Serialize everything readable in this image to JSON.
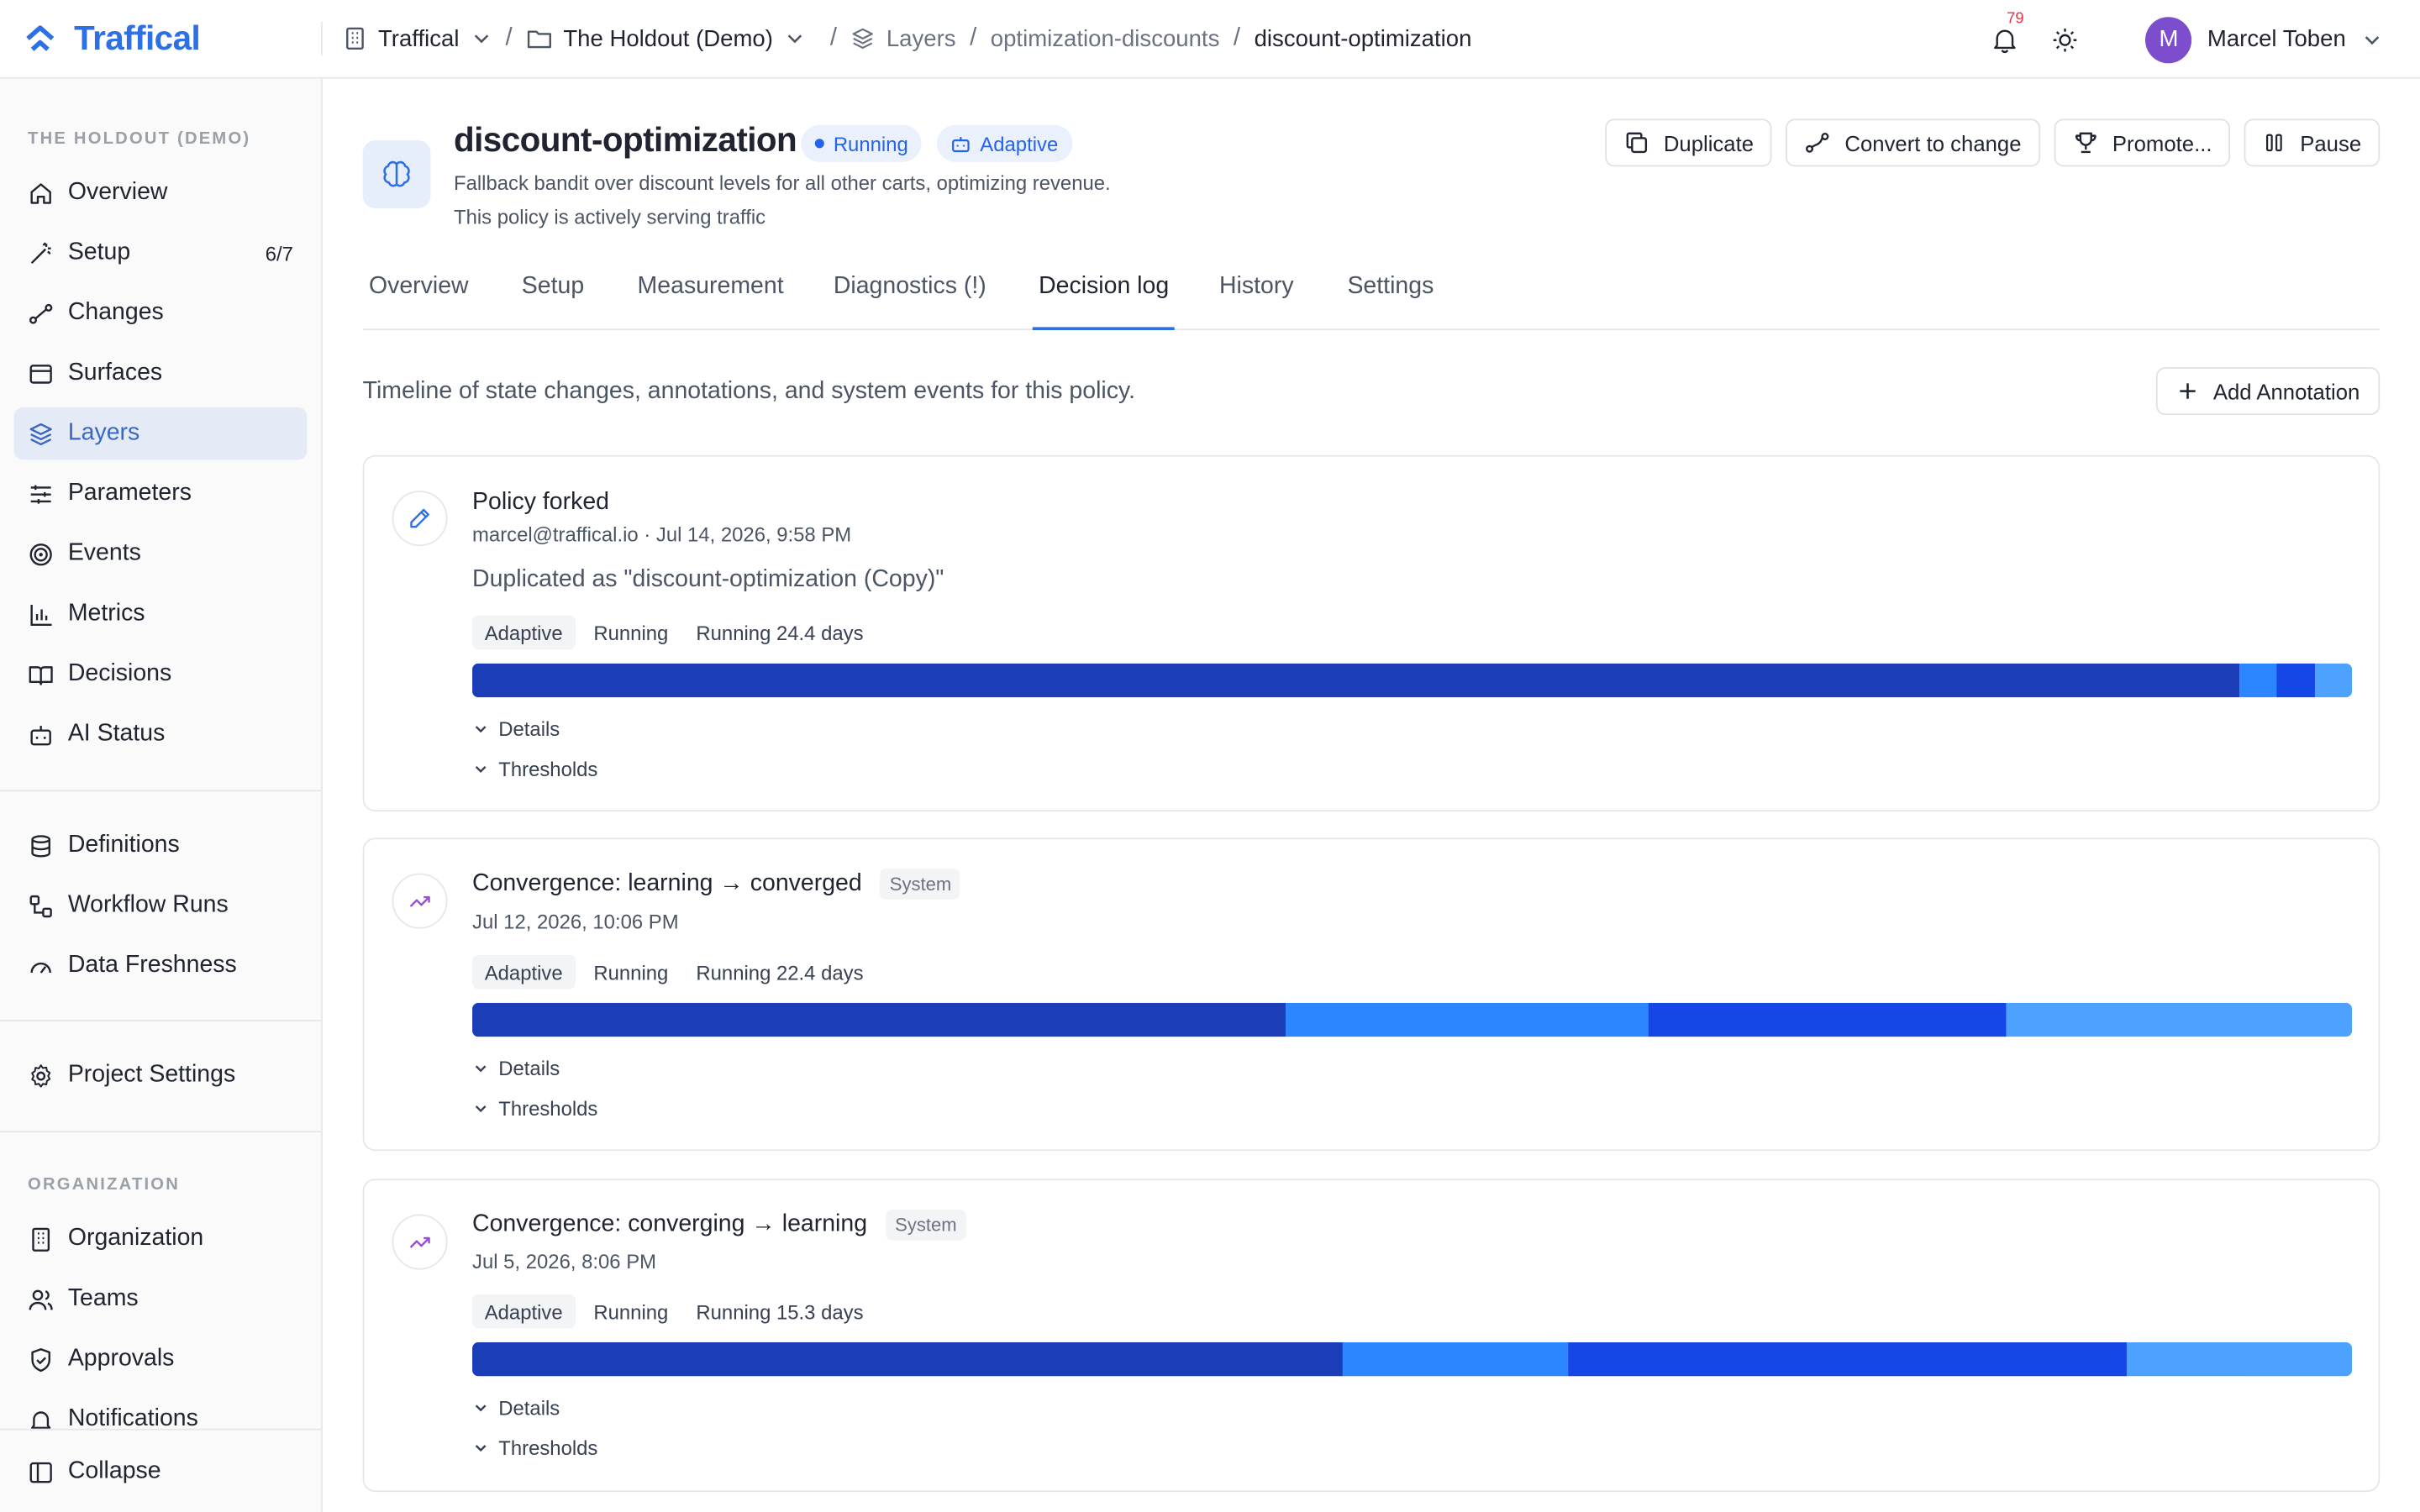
{
  "app": {
    "brand": "Traffical"
  },
  "breadcrumb": {
    "org": "Traffical",
    "project": "The Holdout (Demo)",
    "layers": "Layers",
    "layer": "optimization-discounts",
    "policy": "discount-optimization"
  },
  "top": {
    "notifications_count": "79",
    "user_name": "Marcel Toben",
    "user_initial": "M"
  },
  "sidebar": {
    "project_label": "THE HOLDOUT (DEMO)",
    "items": [
      {
        "label": "Overview",
        "icon": "home-icon"
      },
      {
        "label": "Setup",
        "icon": "wand-icon",
        "count": "6/7"
      },
      {
        "label": "Changes",
        "icon": "route-icon"
      },
      {
        "label": "Surfaces",
        "icon": "browser-icon"
      },
      {
        "label": "Layers",
        "icon": "layers-icon"
      },
      {
        "label": "Parameters",
        "icon": "sliders-icon"
      },
      {
        "label": "Events",
        "icon": "target-icon"
      },
      {
        "label": "Metrics",
        "icon": "bar-chart-icon"
      },
      {
        "label": "Decisions",
        "icon": "book-icon"
      },
      {
        "label": "AI Status",
        "icon": "bot-icon"
      }
    ],
    "items2": [
      {
        "label": "Definitions",
        "icon": "database-icon"
      },
      {
        "label": "Workflow Runs",
        "icon": "workflow-icon"
      },
      {
        "label": "Data Freshness",
        "icon": "gauge-icon"
      }
    ],
    "project_settings": "Project Settings",
    "org_label": "ORGANIZATION",
    "org_items": [
      {
        "label": "Organization",
        "icon": "building-icon"
      },
      {
        "label": "Teams",
        "icon": "users-icon"
      },
      {
        "label": "Approvals",
        "icon": "shield-check-icon"
      },
      {
        "label": "Notifications",
        "icon": "bell-icon"
      }
    ],
    "collapse": "Collapse"
  },
  "policy": {
    "title": "discount-optimization",
    "status": "Running",
    "mode": "Adaptive",
    "description": "Fallback bandit over discount levels for all other carts, optimizing revenue.",
    "serving_note": "This policy is actively serving traffic",
    "actions": {
      "duplicate": "Duplicate",
      "convert": "Convert to change",
      "promote": "Promote...",
      "pause": "Pause"
    }
  },
  "tabs": [
    "Overview",
    "Setup",
    "Measurement",
    "Diagnostics (!)",
    "Decision log",
    "History",
    "Settings"
  ],
  "decision_log": {
    "intro": "Timeline of state changes, annotations, and system events for this policy.",
    "add_annotation": "Add Annotation",
    "details_label": "Details",
    "thresholds_label": "Thresholds",
    "entries": [
      {
        "title": "Policy forked",
        "meta": "marcel@traffical.io · Jul 14, 2026, 9:58 PM",
        "description": "Duplicated as \"discount-optimization (Copy)\"",
        "chips": [
          "Adaptive",
          "Running",
          "Running 24.4 days"
        ],
        "allocation": [
          0.94,
          0.02,
          0.02,
          0.02
        ]
      },
      {
        "title": "Convergence: learning → converged",
        "tag": "System",
        "meta": "Jul 12, 2026, 10:06 PM",
        "chips": [
          "Adaptive",
          "Running",
          "Running 22.4 days"
        ],
        "allocation": [
          0.433,
          0.193,
          0.19,
          0.184
        ]
      },
      {
        "title": "Convergence: converging → learning",
        "tag": "System",
        "meta": "Jul 5, 2026, 8:06 PM",
        "chips": [
          "Adaptive",
          "Running",
          "Running 15.3 days"
        ],
        "allocation": [
          0.463,
          0.12,
          0.297,
          0.12
        ]
      }
    ]
  },
  "colors": {
    "brand": "#2f6fe4",
    "seg1": "#1b3db8",
    "seg2": "#2b86ff",
    "seg3": "#1547e6",
    "seg4": "#4da2ff"
  }
}
